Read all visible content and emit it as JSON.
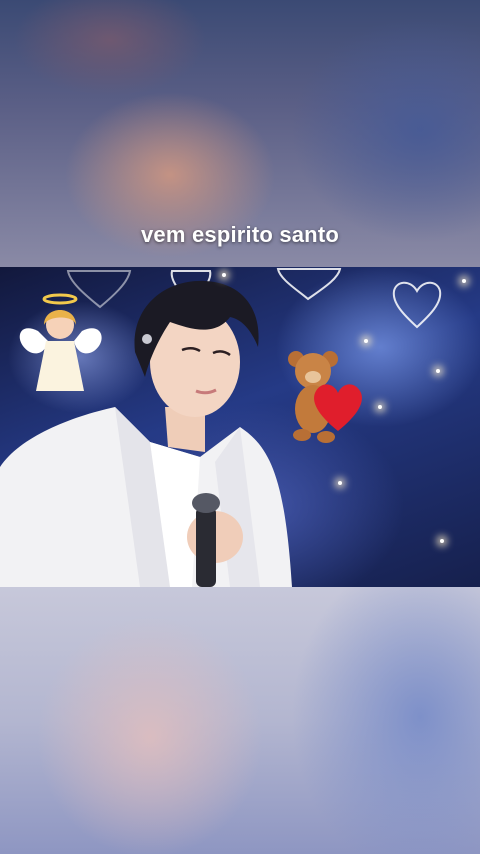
{
  "caption": "vem espirito santo",
  "icons": {
    "angel": "angel-sticker",
    "teddy": "teddy-bear-heart-sticker",
    "hearts": "outline-heart-icon",
    "microphone": "microphone-icon"
  },
  "colors": {
    "caption_text": "#ffffff",
    "suit": "#f4f4f6",
    "heart_red": "#e01e2c"
  }
}
